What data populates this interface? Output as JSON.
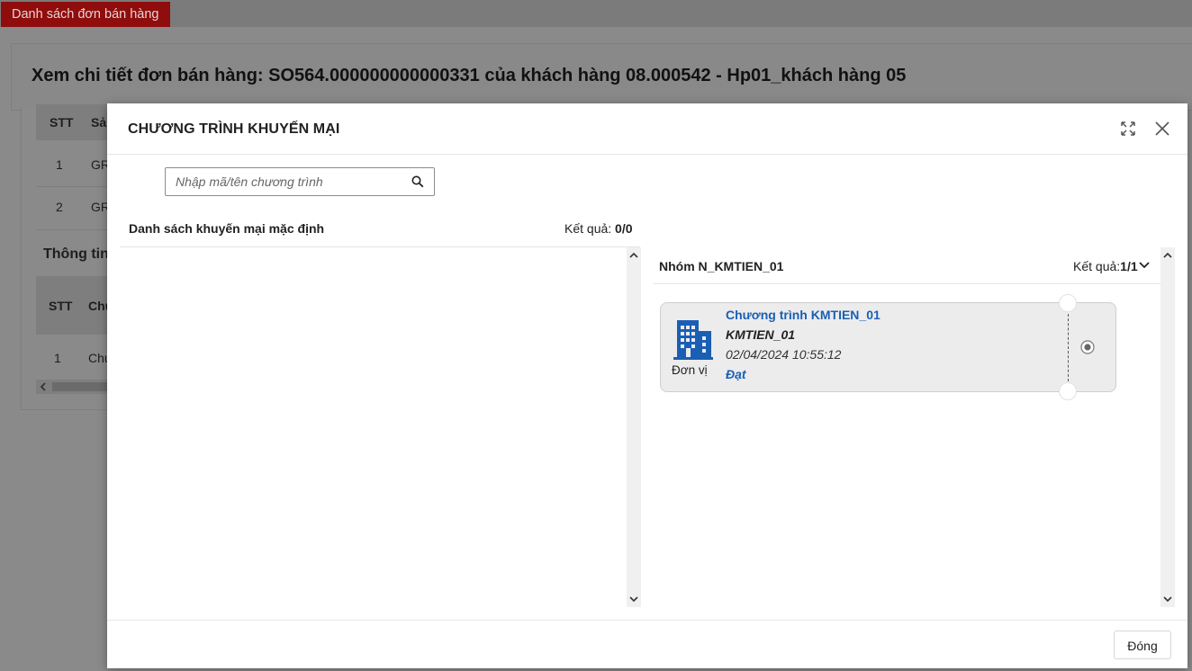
{
  "background": {
    "tab_label": "Danh sách đơn bán hàng",
    "page_title": "Xem chi tiết đơn bán hàng: SO564.000000000000331 của khách hàng 08.000542 - Hp01_khách hàng 05",
    "table1": {
      "header_stt": "STT",
      "header_col2": "Sả",
      "rows": [
        {
          "stt": "1",
          "col2": "GR"
        },
        {
          "stt": "2",
          "col2": "GR"
        }
      ]
    },
    "section2_title": "Thông tin",
    "table2": {
      "header_stt": "STT",
      "header_col2": "Chư",
      "rows": [
        {
          "stt": "1",
          "col2": "Chư"
        }
      ]
    }
  },
  "modal": {
    "title": "CHƯƠNG TRÌNH KHUYẾN MẠI",
    "search": {
      "placeholder": "Nhập mã/tên chương trình",
      "value": ""
    },
    "left_panel": {
      "title": "Danh sách khuyến mại mặc định",
      "result_label": "Kết quả:",
      "result_value": "0/0"
    },
    "right_panel": {
      "group_title": "Nhóm N_KMTIEN_01",
      "result_label": "Kết quả:",
      "result_value": "1/1",
      "cards": [
        {
          "icon": "building-icon",
          "unit_label": "Đơn vị",
          "program_name": "Chương trình KMTIEN_01",
          "program_code": "KMTIEN_01",
          "datetime": "02/04/2024 10:55:12",
          "status": "Đạt",
          "selected": true
        }
      ]
    },
    "footer": {
      "close_label": "Đóng"
    }
  },
  "colors": {
    "tab_red": "#8f0d0d",
    "link_blue": "#1a5fb4",
    "card_bg": "#ececec",
    "overlay": "#8a8a8a"
  }
}
